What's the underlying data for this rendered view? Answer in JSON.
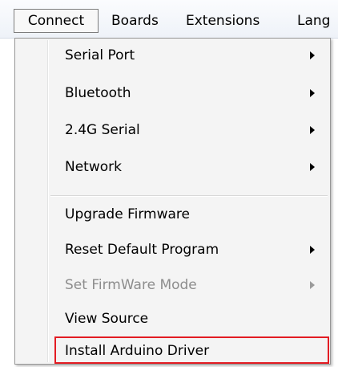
{
  "menubar": {
    "items": [
      {
        "label": "Connect",
        "active": true
      },
      {
        "label": "Boards"
      },
      {
        "label": "Extensions"
      },
      {
        "label": "Lang"
      }
    ]
  },
  "dropdown": {
    "items": [
      {
        "label": "Serial Port",
        "submenu": true,
        "enabled": true
      },
      {
        "label": "Bluetooth",
        "submenu": true,
        "enabled": true
      },
      {
        "label": "2.4G Serial",
        "submenu": true,
        "enabled": true
      },
      {
        "label": "Network",
        "submenu": true,
        "enabled": true
      },
      {
        "label": "Upgrade Firmware",
        "submenu": false,
        "enabled": true
      },
      {
        "label": "Reset Default Program",
        "submenu": true,
        "enabled": true
      },
      {
        "label": "Set FirmWare Mode",
        "submenu": true,
        "enabled": false
      },
      {
        "label": "View Source",
        "submenu": false,
        "enabled": true
      },
      {
        "label": "Install Arduino Driver",
        "submenu": false,
        "enabled": true,
        "highlighted": true
      }
    ]
  },
  "colors": {
    "highlight_border": "#e31c23",
    "disabled_text": "#8d8d8d"
  }
}
